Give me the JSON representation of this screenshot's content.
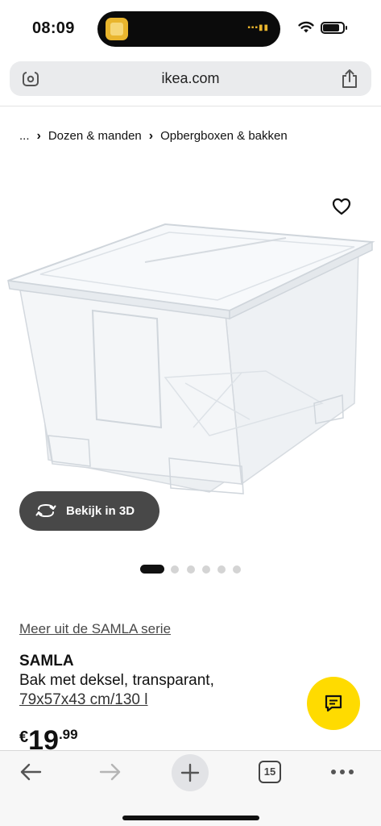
{
  "status_bar": {
    "time": "08:09"
  },
  "browser": {
    "url": "ikea.com"
  },
  "breadcrumb": {
    "ellipsis": "...",
    "items": [
      "Dozen & manden",
      "Opbergboxen & bakken"
    ]
  },
  "gallery": {
    "view_3d_label": "Bekijk in 3D",
    "image_count": 6,
    "active_index": 0
  },
  "product": {
    "series_link": "Meer uit de SAMLA serie",
    "name": "SAMLA",
    "description": "Bak met deksel, transparant,",
    "size": "79x57x43 cm/130 l",
    "price": {
      "currency": "€",
      "whole": "19",
      "decimal": ".99"
    }
  },
  "toolbar": {
    "tab_count": "15"
  },
  "colors": {
    "accent_yellow": "#ffdb00",
    "button_dark": "#484848"
  }
}
